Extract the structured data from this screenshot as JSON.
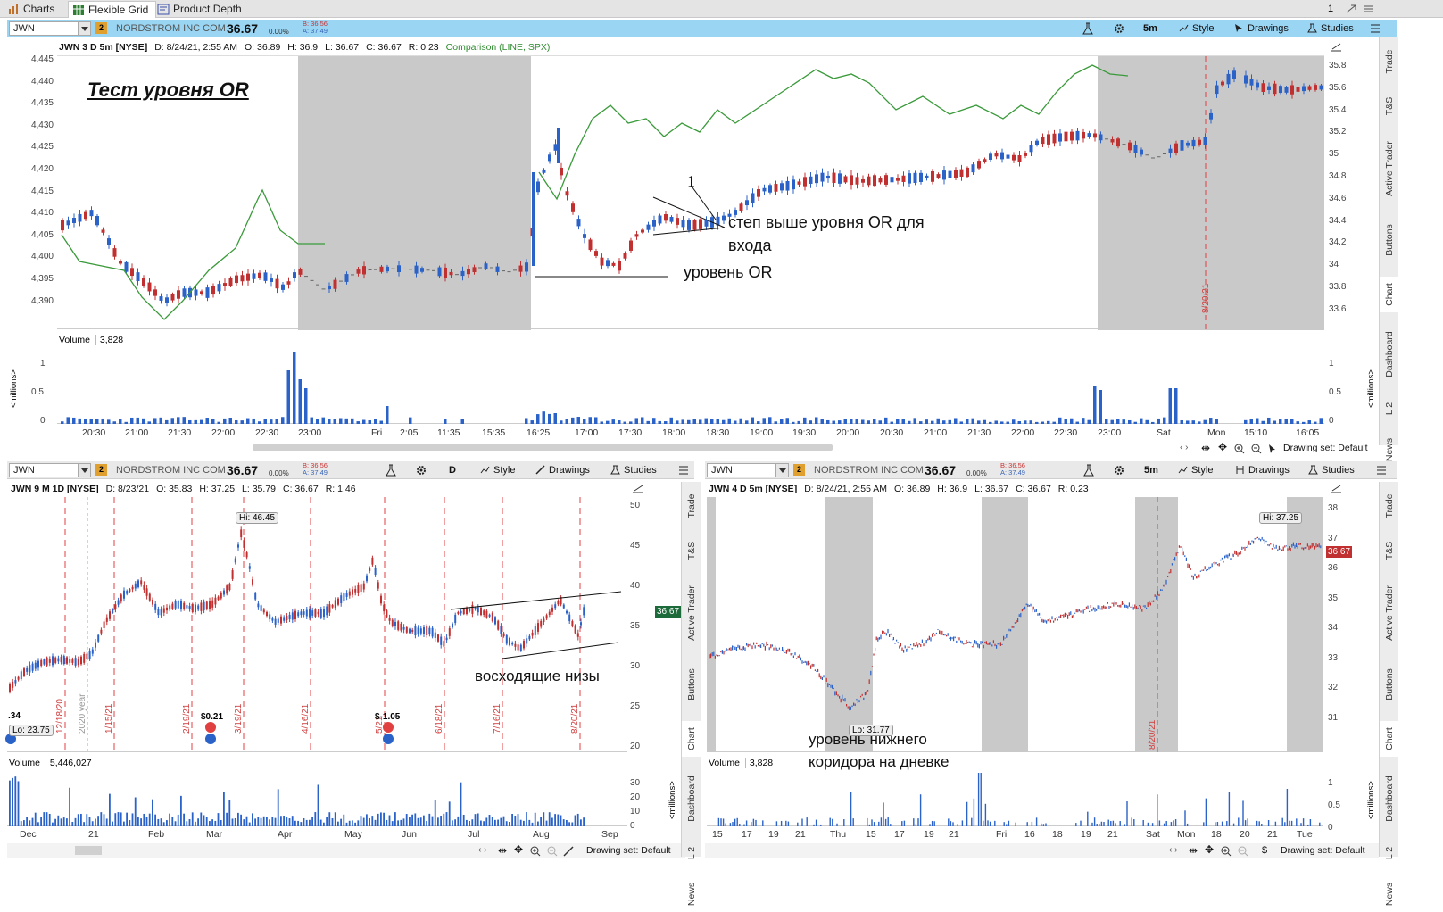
{
  "window": {
    "tabs": [
      {
        "label": "Charts",
        "active": false,
        "icon": "bar-chart-icon"
      },
      {
        "label": "Flexible Grid",
        "active": true,
        "icon": "grid-icon"
      },
      {
        "label": "Product Depth",
        "active": false,
        "icon": "depth-icon"
      }
    ],
    "grid_count": "1"
  },
  "colors": {
    "up": "#2a62c8",
    "down": "#c03030",
    "comparison": "#3a9a3a",
    "header_blue": "#9ad6f4",
    "session_shade": "#c9c9c9",
    "event_red": "#e04040"
  },
  "sidebar_tabs": [
    "Trade",
    "T&S",
    "Active Trader",
    "Buttons",
    "Chart",
    "Dashboard",
    "L 2",
    "News"
  ],
  "main": {
    "symbol": "JWN",
    "company": "NORDSTROM INC COM",
    "last": "36.67",
    "change_pct": "0.00%",
    "bid": "B: 36.56",
    "ask": "A: 37.49",
    "timeframe": "5m",
    "toolbar": {
      "style": "Style",
      "drawings": "Drawings",
      "studies": "Studies"
    },
    "info": {
      "title": "JWN 3 D 5m [NYSE]",
      "date": "D: 8/24/21, 2:55 AM",
      "open": "O: 36.89",
      "high": "H: 36.9",
      "low": "L: 36.67",
      "close": "C: 36.67",
      "range": "R: 0.23",
      "comparison": "Comparison (LINE, SPX)"
    },
    "annotation_title": "Тест уровня OR",
    "annotation_1": "1",
    "annotation_step": "степ выше уровня OR для входа",
    "annotation_step_line1": "степ выше уровня OR для",
    "annotation_step_line2": "входа",
    "annotation_level": "уровень OR",
    "left_axis": [
      "4,445",
      "4,440",
      "4,435",
      "4,430",
      "4,425",
      "4,420",
      "4,415",
      "4,410",
      "4,405",
      "4,400",
      "4,395",
      "4,390"
    ],
    "right_axis": [
      "35.8",
      "35.6",
      "35.4",
      "35.2",
      "35",
      "34.8",
      "34.6",
      "34.4",
      "34.2",
      "34",
      "33.8",
      "33.6"
    ],
    "date_marker": "8/20/21",
    "volume": {
      "label": "Volume",
      "value": "3,828",
      "unit": "<millions>",
      "ticks": [
        "1",
        "0.5",
        "0"
      ]
    },
    "time_axis": [
      "20:30",
      "21:00",
      "21:30",
      "22:00",
      "22:30",
      "23:00",
      "Fri",
      "2:05",
      "11:35",
      "15:35",
      "16:25",
      "17:00",
      "17:30",
      "18:00",
      "18:30",
      "19:00",
      "19:30",
      "20:00",
      "20:30",
      "21:00",
      "21:30",
      "22:00",
      "22:30",
      "23:00",
      "Sat",
      "Mon",
      "15:10",
      "16:05"
    ],
    "drawing_set": "Drawing set: Default"
  },
  "bottom_left": {
    "symbol": "JWN",
    "company": "NORDSTROM INC COM",
    "last": "36.67",
    "change_pct": "0.00%",
    "bid": "B: 36.56",
    "ask": "A: 37.49",
    "timeframe": "D",
    "toolbar": {
      "style": "Style",
      "drawings": "Drawings",
      "studies": "Studies"
    },
    "info": {
      "title": "JWN 9 M 1D [NYSE]",
      "date": "D: 8/23/21",
      "open": "O: 35.83",
      "high": "H: 37.25",
      "low": "L: 35.79",
      "close": "C: 36.67",
      "range": "R: 1.46"
    },
    "hi_label": "Hi: 46.45",
    "lo_label": "Lo: 23.75",
    "left_cut_label": ".34",
    "price_tag": "36.67",
    "dividend_1": "$0.21",
    "dividend_2": "$-1.05",
    "annotation": "восходящие низы",
    "year_marker": "2020 year",
    "date_markers": [
      "12/18/20",
      "1/15/21",
      "2/19/21",
      "3/19/21",
      "4/16/21",
      "5/21",
      "6/18/21",
      "7/16/21",
      "8/20/21"
    ],
    "right_axis": [
      "50",
      "45",
      "40",
      "35",
      "30",
      "25",
      "20"
    ],
    "volume": {
      "label": "Volume",
      "value": "5,446,027",
      "unit": "<millions>",
      "ticks": [
        "30",
        "20",
        "10",
        "0"
      ]
    },
    "time_axis": [
      "Dec",
      "21",
      "Feb",
      "Mar",
      "Apr",
      "May",
      "Jun",
      "Jul",
      "Aug",
      "Sep"
    ],
    "drawing_set": "Drawing set: Default"
  },
  "bottom_right": {
    "symbol": "JWN",
    "company": "NORDSTROM INC COM",
    "last": "36.67",
    "change_pct": "0.00%",
    "bid": "B: 36.56",
    "ask": "A: 37.49",
    "timeframe": "5m",
    "toolbar": {
      "style": "Style",
      "drawings": "Drawings",
      "studies": "Studies"
    },
    "info": {
      "title": "JWN 4 D 5m [NYSE]",
      "date": "D: 8/24/21, 2:55 AM",
      "open": "O: 36.89",
      "high": "H: 36.9",
      "low": "L: 36.67",
      "close": "C: 36.67",
      "range": "R: 0.23"
    },
    "hi_label": "Hi: 37.25",
    "lo_label": "Lo: 31.77",
    "price_tag": "36.67",
    "annotation_line1": "уровень нижнего",
    "annotation_line2": "коридора на дневке",
    "date_marker": "8/20/21",
    "right_axis": [
      "38",
      "37",
      "36",
      "35",
      "34",
      "33",
      "32",
      "31"
    ],
    "volume": {
      "label": "Volume",
      "value": "3,828",
      "unit": "<millions>",
      "ticks": [
        "1",
        "0.5",
        "0"
      ]
    },
    "time_axis": [
      "15",
      "17",
      "19",
      "21",
      "Thu",
      "15",
      "17",
      "19",
      "21",
      "Fri",
      "16",
      "18",
      "19",
      "21",
      "Sat",
      "Mon",
      "18",
      "20",
      "21",
      "Tue"
    ],
    "drawing_set": "Drawing set: Default"
  }
}
